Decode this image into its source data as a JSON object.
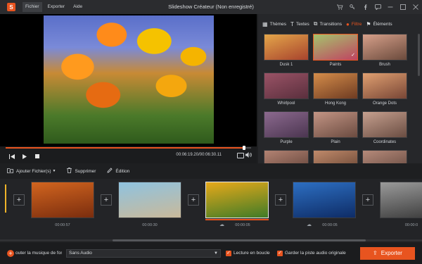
{
  "app": {
    "title": "Slideshow Créateur (Non enregistré)"
  },
  "menu": {
    "items": [
      "Fichier",
      "Exporter",
      "Aide"
    ]
  },
  "window_icons": [
    "cart-icon",
    "key-icon",
    "facebook-icon",
    "chat-icon",
    "minimize-icon",
    "restore-icon",
    "close-icon"
  ],
  "player": {
    "timecode": "00:06:19.20/00:06:30.11",
    "progress": 0.97
  },
  "panel": {
    "tabs": [
      {
        "label": "Thèmes",
        "icon": "themes-icon",
        "active": false
      },
      {
        "label": "Textes",
        "icon": "text-icon",
        "active": false
      },
      {
        "label": "Transitions",
        "icon": "transitions-icon",
        "active": false
      },
      {
        "label": "Filtre",
        "icon": "filter-icon",
        "active": true
      },
      {
        "label": "Éléments",
        "icon": "elements-icon",
        "active": false
      }
    ],
    "filters": [
      {
        "label": "Dusk 1",
        "colors": [
          "#e4a64a",
          "#a7432d"
        ],
        "selected": false
      },
      {
        "label": "Paints",
        "colors": [
          "#a5c46d",
          "#c04361"
        ],
        "selected": true
      },
      {
        "label": "Brush",
        "colors": [
          "#d7a08a",
          "#6a4a3c"
        ],
        "selected": false
      },
      {
        "label": "Whirlpool",
        "colors": [
          "#9a5366",
          "#5a2f3d"
        ],
        "selected": false
      },
      {
        "label": "Hong Kong",
        "colors": [
          "#d58d4a",
          "#6e3b22"
        ],
        "selected": false
      },
      {
        "label": "Orange Dots",
        "colors": [
          "#e0a071",
          "#784636"
        ],
        "selected": false
      },
      {
        "label": "Purple",
        "colors": [
          "#8c6a8f",
          "#4b3550"
        ],
        "selected": false
      },
      {
        "label": "Plain",
        "colors": [
          "#c39585",
          "#6b4b40"
        ],
        "selected": false
      },
      {
        "label": "Coordinates",
        "colors": [
          "#c6a08f",
          "#6a4d42"
        ],
        "selected": false
      },
      {
        "label": "",
        "colors": [
          "#b38373",
          "#5a3d34"
        ],
        "selected": false
      },
      {
        "label": "",
        "colors": [
          "#c08a6b",
          "#5f3e2e"
        ],
        "selected": false
      },
      {
        "label": "",
        "colors": [
          "#b68a7a",
          "#5e443b"
        ],
        "selected": false
      }
    ]
  },
  "toolbar": {
    "add_files": "Ajouter Fichier(s)",
    "delete": "Supprimer",
    "edit": "Édition"
  },
  "timeline": {
    "clips": [
      {
        "duration": "00:00:57",
        "colors": [
          "#d2651f",
          "#7a2d0e"
        ],
        "selected": false,
        "has_effect": false
      },
      {
        "duration": "00:00:30",
        "colors": [
          "#8fc3e0",
          "#c9b99a"
        ],
        "selected": false,
        "has_effect": false
      },
      {
        "duration": "00:00:05",
        "colors": [
          "#e7a91a",
          "#3f7b27"
        ],
        "selected": true,
        "has_effect": true
      },
      {
        "duration": "00:00:05",
        "colors": [
          "#2d6fc2",
          "#0e2c66"
        ],
        "selected": false,
        "has_effect": true
      },
      {
        "duration": "00:00:0",
        "colors": [
          "#9a9a9a",
          "#3a3a3a"
        ],
        "selected": false,
        "has_effect": false
      }
    ]
  },
  "bottom": {
    "music_label": "outer la musique de fond",
    "audio_select": "Sans Audio",
    "loop_label": "Lecture en boucle",
    "loop_checked": true,
    "keep_audio_label": "Garder la piste audio originale",
    "keep_audio_checked": true,
    "export_label": "Exporter"
  },
  "colors": {
    "accent": "#e8541f",
    "background": "#1e1f21",
    "panel": "#26272a"
  }
}
